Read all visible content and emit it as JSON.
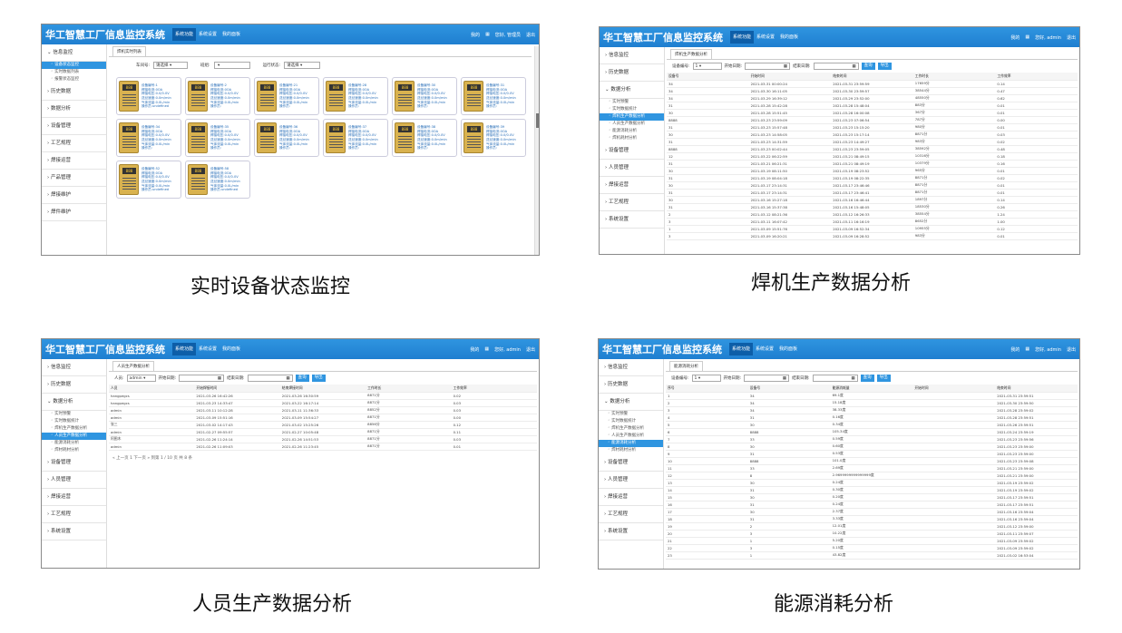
{
  "app_title": "华工智慧工厂信息监控系统",
  "nav": [
    "系统功能",
    "系统设置",
    "我的面板"
  ],
  "captions": [
    "实时设备状态监控",
    "焊机生产数据分析",
    "人员生产数据分析",
    "能源消耗分析"
  ],
  "p1": {
    "header_right": [
      "我的",
      "",
      "您好, 管理员",
      "退出"
    ],
    "sidebar": {
      "groups": [
        "信息监控",
        "历史数据",
        "数据分析",
        "设备管理",
        "工艺规程",
        "焊接运营",
        "产品管理",
        "焊接维护",
        "焊件维护"
      ],
      "subs": [
        "设备状态监控",
        "实时数据列表",
        "报警状态监控"
      ]
    },
    "tab": "焊机实时列表",
    "filters": {
      "group_label": "车间号:",
      "group_value": "请选择",
      "team_label": "班组:",
      "status_label": "运行状态:",
      "status_value": "请选择"
    },
    "cards": [
      {
        "no": "1",
        "cur": "0OA",
        "volt": "0.0/0.0V",
        "speed": "0.0m/min",
        "gas": "0.0L/min",
        "person": "undefined"
      },
      {
        "no": "2",
        "cur": "0OA",
        "volt": "0.0/0.0V",
        "speed": "0.0m/min",
        "gas": "0.0L/min",
        "person": ""
      },
      {
        "no": "21",
        "cur": "0OA",
        "volt": "0.0/0.0V",
        "speed": "0.0m/min",
        "gas": "0.0L/min",
        "person": ""
      },
      {
        "no": "28",
        "cur": "0OA",
        "volt": "0.0/0.0V",
        "speed": "0.0m/min",
        "gas": "0.0L/min",
        "person": ""
      },
      {
        "no": "30",
        "cur": "0OA",
        "volt": "0.0/0.0V",
        "speed": "0.0m/min",
        "gas": "0.0L/min",
        "person": ""
      },
      {
        "no": "31",
        "cur": "0OA",
        "volt": "0.0/0.0V",
        "speed": "0.0m/min",
        "gas": "0.0L/min",
        "person": ""
      },
      {
        "no": "34",
        "cur": "0OA",
        "volt": "0.0/0.0V",
        "speed": "0.0m/min",
        "gas": "0.0L/min",
        "person": ""
      },
      {
        "no": "35",
        "cur": "0OA",
        "volt": "0.0/0.0V",
        "speed": "0.0m/min",
        "gas": "0.0L/min",
        "person": ""
      },
      {
        "no": "36",
        "cur": "0OA",
        "volt": "0.0/0.0V",
        "speed": "0.0m/min",
        "gas": "0.0L/min",
        "person": ""
      },
      {
        "no": "37",
        "cur": "0OA",
        "volt": "0.0/0.0V",
        "speed": "0.0m/min",
        "gas": "0.0L/min",
        "person": ""
      },
      {
        "no": "38",
        "cur": "0OA",
        "volt": "0.0/0.0V",
        "speed": "0.0m/min",
        "gas": "0.0L/min",
        "person": ""
      },
      {
        "no": "39",
        "cur": "0OA",
        "volt": "0.0/0.0V",
        "speed": "0.0m/min",
        "gas": "0.0L/min",
        "person": ""
      },
      {
        "no": "52",
        "cur": "0OA",
        "volt": "0.0/0.0V",
        "speed": "0.0m/min",
        "gas": "0.0L/min",
        "person": "undefined"
      },
      {
        "no": "58",
        "cur": "0OA",
        "volt": "0.0/0.0V",
        "speed": "0.0m/min",
        "gas": "0.0L/min",
        "person": "undefined"
      }
    ],
    "card_labels": {
      "no": "设备编号:",
      "cur": "焊接电流:",
      "volt": "焊接电压:",
      "speed": "送丝速度:",
      "gas": "气体流量:",
      "person": "操作员:"
    },
    "screen_text": "888"
  },
  "p2": {
    "header_right": [
      "我的",
      "",
      "您好, admin",
      "退出"
    ],
    "sidebar": {
      "groups": [
        "信息监控",
        "历史数据",
        "数据分析",
        "设备管理",
        "人员管理",
        "焊接运营",
        "工艺规程",
        "系统设置"
      ],
      "subs": [
        "实时预警",
        "实时数据统计",
        "焊机生产数据分析",
        "人员生产数据分析",
        "能源消耗分析",
        "焊机耗材分析"
      ]
    },
    "tab": "焊机生产数据分析",
    "filters": {
      "label1": "设备编号:",
      "value1": "1",
      "label2": "开始日期:",
      "label3": "结束日期:",
      "btn1": "查询",
      "btn2": "导出"
    },
    "columns": [
      "设备号",
      "开始时间",
      "结束时间",
      "工作时长",
      "工作效率"
    ],
    "rows": [
      [
        "34",
        "2021-03-31 00:00:24",
        "2021-03-31 23:59:59",
        "17659分",
        "0.14"
      ],
      [
        "34",
        "2021-03-30 16:11:05",
        "2021-03-30 23:59:57",
        "38544分",
        "0.47"
      ],
      [
        "34",
        "2021-03-29 16:39:12",
        "2021-03-29 23:52:00",
        "48550分",
        "0.62"
      ],
      [
        "31",
        "2021-03-28 15:42:28",
        "2021-03-28 15:48:04",
        "883分",
        "0.01"
      ],
      [
        "30",
        "2021-03-28 15:51:45",
        "2021-03-28 16:00:08",
        "367分",
        "0.01"
      ],
      [
        "8888",
        "2021-03-23 23:59:09",
        "2021-03-23 07:06:54",
        "787分",
        "0.00"
      ],
      [
        "31",
        "2021-03-23 15:57:48",
        "2021-03-23 15:15:20",
        "980分",
        "0.01"
      ],
      [
        "30",
        "2021-03-23 14:58:05",
        "2021-03-23 15:17:14",
        "8871分",
        "0.03"
      ],
      [
        "31",
        "2021-03-23 14:31:59",
        "2021-03-23 14:49:27",
        "983分",
        "0.02"
      ],
      [
        "8888",
        "2021-03-23 00:02:44",
        "2021-03-23 23:59:05",
        "38592分",
        "0.48"
      ],
      [
        "12",
        "2021-03-22 06:22:59",
        "2021-03-21 08:49:15",
        "10316分",
        "0.18"
      ],
      [
        "31",
        "2021-03-21 06:21:31",
        "2021-03-21 08:49:19",
        "10379分",
        "0.16"
      ],
      [
        "30",
        "2021-03-19 08:11:50",
        "2021-03-19 08:23:52",
        "965分",
        "0.01"
      ],
      [
        "31",
        "2021-03-19 08:04:18",
        "2021-03-19 08:22:35",
        "8871分",
        "0.02"
      ],
      [
        "30",
        "2021-03-17 23:14:31",
        "2021-03-17 23:46:46",
        "8871分",
        "0.01"
      ],
      [
        "31",
        "2021-03-17 23:14:31",
        "2021-03-17 23:46:41",
        "8871分",
        "0.01"
      ],
      [
        "30",
        "2021-03-16 15:27:18",
        "2021-03-16 16:46:44",
        "1897分",
        "0.14"
      ],
      [
        "31",
        "2021-03-16 15:37:38",
        "2021-03-16 15:48:05",
        "18530分",
        "0.26"
      ],
      [
        "2",
        "2021-03-12 08:21:36",
        "2021-03-12 16:26:33",
        "38554分",
        "1.24"
      ],
      [
        "3",
        "2021-03-11 16:07:42",
        "2021-03-11 16:16:19",
        "8652分",
        "1.00"
      ],
      [
        "1",
        "2021-03-09 15:51:76",
        "2021-03-09 16:52:34",
        "10955分",
        "0.12"
      ],
      [
        "3",
        "2021-03-09 16:20:21",
        "2021-03-09 16:28:52",
        "983分",
        "0.01"
      ]
    ]
  },
  "p3": {
    "header_right": [
      "我的",
      "",
      "您好, admin",
      "退出"
    ],
    "sidebar": {
      "groups": [
        "信息监控",
        "历史数据",
        "数据分析",
        "设备管理",
        "人员管理",
        "焊接运营",
        "工艺规程",
        "系统设置"
      ],
      "subs": [
        "实时预警",
        "实时数据统计",
        "焊机生产数据分析",
        "人员生产数据分析",
        "能源消耗分析",
        "焊材耗材分析"
      ]
    },
    "tab": "人员生产数据分析",
    "filters": {
      "label1": "人员:",
      "value1": "admin",
      "label2": "开始日期:",
      "label3": "结束日期:",
      "btn1": "查询",
      "btn2": "导出"
    },
    "columns": [
      "人员",
      "开始焊接时间",
      "结束焊接时间",
      "工作时长",
      "工作效率"
    ],
    "rows": [
      [
        "hangpegcs",
        "2021-03-26 16:42:26",
        "2021-03-26 16:30:59",
        "8871分",
        "0.02"
      ],
      [
        "hangpegcs",
        "2021-03-23 14:33:47",
        "2021-03-22 16:17:14",
        "8871分",
        "0.03"
      ],
      [
        "admin",
        "2021-03-11 10:12:28",
        "2021-03-11 11:36:33",
        "8852分",
        "0.03"
      ],
      [
        "admin",
        "2021-03-09 15:51:16",
        "2021-03-09 15:54:27",
        "8871分",
        "0.00"
      ],
      [
        "张三",
        "2021-03-02 14:17:43",
        "2021-03-02 15:25:26",
        "8856分",
        "0.12"
      ],
      [
        "admin",
        "2021-02-27 09:55:57",
        "2021-02-27 10:05:48",
        "8871分",
        "0.11"
      ],
      [
        "阿图木",
        "2021-02-26 11:24:14",
        "2021-02-26 14:51:53",
        "8871分",
        "0.03"
      ],
      [
        "admin",
        "2021-02-26 11:09:03",
        "2021-02-26 11:23:45",
        "8871分",
        "0.01"
      ]
    ],
    "pager": "« 上一页   1   下一页 »   到第  1  / 10  页  共 8 条"
  },
  "p4": {
    "header_right": [
      "我的",
      "",
      "您好, admin",
      "退出"
    ],
    "sidebar": {
      "groups": [
        "信息监控",
        "历史数据",
        "数据分析",
        "设备管理",
        "人员管理",
        "焊接运营",
        "工艺规程",
        "系统设置"
      ],
      "subs": [
        "实时预警",
        "实时数据统计",
        "焊机生产数据分析",
        "人员生产数据分析",
        "能源消耗分析",
        "焊材耗材分析"
      ]
    },
    "tab": "能源消耗分析",
    "filters": {
      "label1": "设备编号:",
      "value1": "1",
      "label2": "开始日期:",
      "label3": "结束日期:",
      "btn1": "查询",
      "btn2": "导出"
    },
    "columns": [
      "序号",
      "设备号",
      "能源消耗量",
      "开始时间",
      "结束时间"
    ],
    "rows": [
      [
        "1",
        "34",
        "69.1度",
        "",
        "2021-03-31 23:59:51"
      ],
      [
        "2",
        "34",
        "15.18度",
        "",
        "2021-03-30 23:59:50"
      ],
      [
        "3",
        "34",
        "38.33度",
        "",
        "2021-03-28 23:59:02"
      ],
      [
        "4",
        "31",
        "0.16度",
        "",
        "2021-03-28 23:59:51"
      ],
      [
        "5",
        "30",
        "0.34度",
        "",
        "2021-03-26 23:59:51"
      ],
      [
        "6",
        "8888",
        "105.34度",
        "",
        "2021-03-24 23:59:19"
      ],
      [
        "7",
        "33",
        "0.59度",
        "",
        "2021-03-23 23:59:56"
      ],
      [
        "8",
        "30",
        "0.60度",
        "",
        "2021-03-23 23:59:00"
      ],
      [
        "9",
        "31",
        "0.53度",
        "",
        "2021-03-23 23:59:00"
      ],
      [
        "10",
        "8888",
        "101.0度",
        "",
        "2021-03-23 23:59:08"
      ],
      [
        "11",
        "33",
        "2.69度",
        "",
        "2021-03-21 23:59:00"
      ],
      [
        "12",
        "8",
        "2.9699999999999999度",
        "",
        "2021-03-21 23:59:00"
      ],
      [
        "13",
        "30",
        "0.24度",
        "",
        "2021-03-19 23:59:02"
      ],
      [
        "14",
        "31",
        "0.30度",
        "",
        "2021-03-19 23:59:02"
      ],
      [
        "15",
        "30",
        "0.20度",
        "",
        "2021-03-17 23:59:51"
      ],
      [
        "16",
        "31",
        "0.24度",
        "",
        "2021-03-17 23:59:51"
      ],
      [
        "17",
        "30",
        "2.37度",
        "",
        "2021-03-16 23:59:04"
      ],
      [
        "18",
        "31",
        "3.33度",
        "",
        "2021-03-16 23:59:04"
      ],
      [
        "19",
        "2",
        "12.01度",
        "",
        "2021-03-12 23:59:00"
      ],
      [
        "20",
        "3",
        "10.22度",
        "",
        "2021-03-11 23:59:07"
      ],
      [
        "21",
        "1",
        "5.20度",
        "",
        "2021-03-09 23:59:02"
      ],
      [
        "22",
        "3",
        "0.15度",
        "",
        "2021-03-09 23:59:02"
      ],
      [
        "23",
        "1",
        "43.82度",
        "",
        "2021-03-02 16:53:04"
      ]
    ]
  }
}
